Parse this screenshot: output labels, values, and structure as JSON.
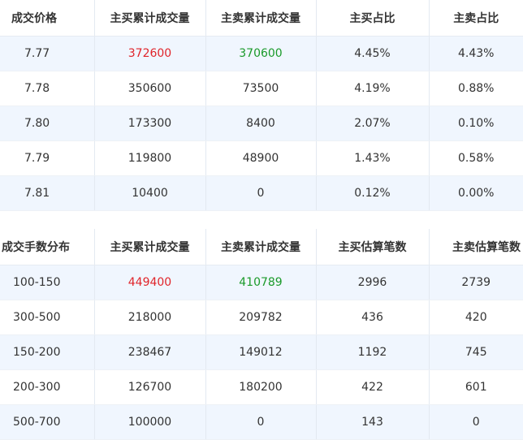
{
  "price_table": {
    "headers": [
      "成交价格",
      "主买累计成交量",
      "主卖累计成交量",
      "主买占比",
      "主卖占比"
    ],
    "rows": [
      [
        "7.77",
        "372600",
        "370600",
        "4.45%",
        "4.43%"
      ],
      [
        "7.78",
        "350600",
        "73500",
        "4.19%",
        "0.88%"
      ],
      [
        "7.80",
        "173300",
        "8400",
        "2.07%",
        "0.10%"
      ],
      [
        "7.79",
        "119800",
        "48900",
        "1.43%",
        "0.58%"
      ],
      [
        "7.81",
        "10400",
        "0",
        "0.12%",
        "0.00%"
      ]
    ]
  },
  "lot_table": {
    "headers": [
      "成交手数分布",
      "主买累计成交量",
      "主卖累计成交量",
      "主买估算笔数",
      "主卖估算笔数"
    ],
    "rows": [
      [
        "100-150",
        "449400",
        "410789",
        "2996",
        "2739"
      ],
      [
        "300-500",
        "218000",
        "209782",
        "436",
        "420"
      ],
      [
        "150-200",
        "238467",
        "149012",
        "1192",
        "745"
      ],
      [
        "200-300",
        "126700",
        "180200",
        "422",
        "601"
      ],
      [
        "500-700",
        "100000",
        "0",
        "143",
        "0"
      ]
    ]
  },
  "colors": {
    "highlight_buy": "#e0242a",
    "highlight_sell": "#1a9a2a",
    "row_stripe": "#f0f6fe"
  }
}
